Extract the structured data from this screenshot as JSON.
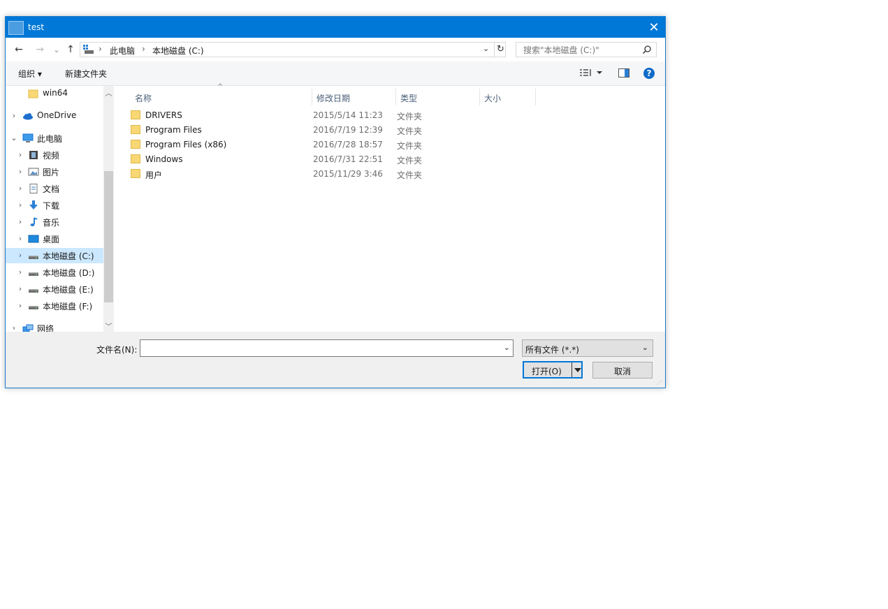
{
  "window": {
    "title": "test",
    "close_glyph": "✕"
  },
  "navbar": {
    "back_glyph": "←",
    "forward_glyph": "→",
    "recent_glyph": "⌄",
    "up_glyph": "↑",
    "path": [
      "此电脑",
      "本地磁盘 (C:)"
    ],
    "path_sep": "›",
    "refresh_glyph": "↻",
    "dropdown_glyph": "⌄",
    "search_placeholder": "搜索\"本地磁盘 (C:)\""
  },
  "toolbar": {
    "organize": "组织 ▾",
    "new_folder": "新建文件夹"
  },
  "nav": [
    {
      "label": "win64",
      "icon": "folder-icon",
      "chev": "",
      "indent": 1
    },
    {
      "label": "OneDrive",
      "icon": "cloud-icon",
      "chev": "›",
      "indent": 0
    },
    {
      "label": "此电脑",
      "icon": "computer-icon",
      "chev": "⌄",
      "indent": 0
    },
    {
      "label": "视频",
      "icon": "video-icon",
      "chev": "›",
      "indent": 1
    },
    {
      "label": "图片",
      "icon": "picture-icon",
      "chev": "›",
      "indent": 1
    },
    {
      "label": "文档",
      "icon": "document-icon",
      "chev": "›",
      "indent": 1
    },
    {
      "label": "下载",
      "icon": "download-icon",
      "chev": "›",
      "indent": 1
    },
    {
      "label": "音乐",
      "icon": "music-icon",
      "chev": "›",
      "indent": 1
    },
    {
      "label": "桌面",
      "icon": "desktop-icon",
      "chev": "›",
      "indent": 1
    },
    {
      "label": "本地磁盘 (C:)",
      "icon": "drive-icon",
      "chev": "›",
      "indent": 1,
      "selected": true
    },
    {
      "label": "本地磁盘 (D:)",
      "icon": "drive-icon",
      "chev": "›",
      "indent": 1
    },
    {
      "label": "本地磁盘 (E:)",
      "icon": "drive-icon",
      "chev": "›",
      "indent": 1
    },
    {
      "label": "本地磁盘 (F:)",
      "icon": "drive-icon",
      "chev": "›",
      "indent": 1
    },
    {
      "label": "网络",
      "icon": "network-icon",
      "chev": "›",
      "indent": 0
    }
  ],
  "columns": {
    "name": "名称",
    "modified": "修改日期",
    "type": "类型",
    "size": "大小",
    "sort_glyph": "^"
  },
  "files": [
    {
      "name": "DRIVERS",
      "modified": "2015/5/14 11:23",
      "type": "文件夹"
    },
    {
      "name": "Program Files",
      "modified": "2016/7/19 12:39",
      "type": "文件夹"
    },
    {
      "name": "Program Files (x86)",
      "modified": "2016/7/28 18:57",
      "type": "文件夹"
    },
    {
      "name": "Windows",
      "modified": "2016/7/31 22:51",
      "type": "文件夹"
    },
    {
      "name": "用户",
      "modified": "2015/11/29 3:46",
      "type": "文件夹"
    }
  ],
  "bottom": {
    "filename_label": "文件名(N):",
    "filename_value": "",
    "filter_value": "所有文件 (*.*)",
    "open_label": "打开(O)",
    "cancel_label": "取消"
  },
  "colors": {
    "accent": "#0078d7",
    "selected": "#cce8ff",
    "folder": "#f8d775"
  }
}
